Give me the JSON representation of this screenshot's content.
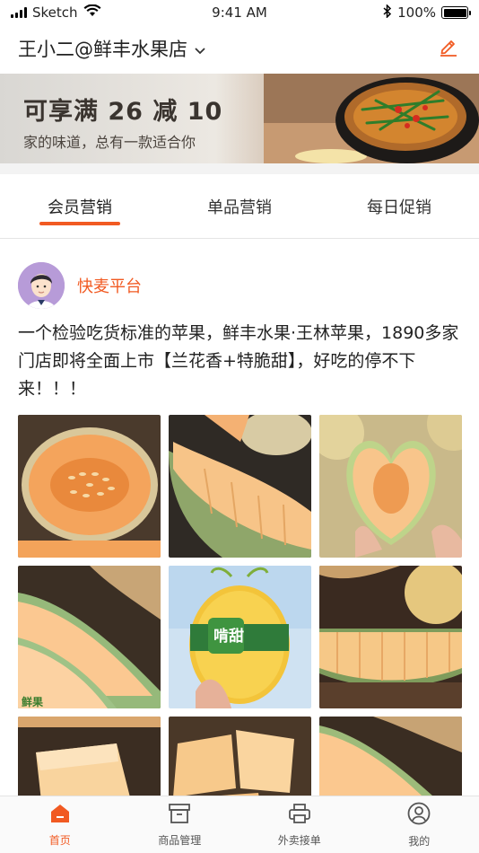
{
  "status_bar": {
    "carrier": "Sketch",
    "time": "9:41 AM",
    "battery": "100%"
  },
  "header": {
    "store_name": "王小二@鲜丰水果店"
  },
  "banner": {
    "title": "可享满 26 减 10",
    "subtitle": "家的味道，总有一款适合你"
  },
  "tabs": [
    {
      "label": "会员营销",
      "active": true
    },
    {
      "label": "单品营销",
      "active": false
    },
    {
      "label": "每日促销",
      "active": false
    }
  ],
  "post": {
    "author": "快麦平台",
    "text": "一个检验吃货标准的苹果，鲜丰水果·王林苹果，1890多家门店即将全面上市【兰花香+特脆甜】，好吃的停不下来！！！",
    "photo_badge_text": "啃甜"
  },
  "bottom_nav": [
    {
      "label": "首页",
      "icon": "home-icon",
      "active": true
    },
    {
      "label": "商品管理",
      "icon": "box-icon",
      "active": false
    },
    {
      "label": "外卖接单",
      "icon": "printer-icon",
      "active": false
    },
    {
      "label": "我的",
      "icon": "user-icon",
      "active": false
    }
  ],
  "colors": {
    "accent": "#f15a22"
  }
}
